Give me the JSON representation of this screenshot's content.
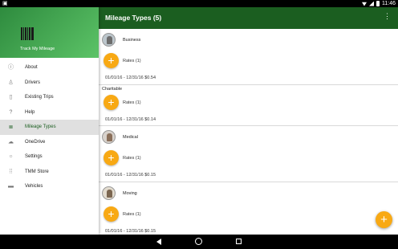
{
  "status_bar": {
    "time": "11:46"
  },
  "drawer": {
    "app_title": "Track My Mileage",
    "items": [
      {
        "label": "About",
        "icon": "info-icon"
      },
      {
        "label": "Drivers",
        "icon": "person-icon"
      },
      {
        "label": "Existing Trips",
        "icon": "clipboard-icon"
      },
      {
        "label": "Help",
        "icon": "help-icon"
      },
      {
        "label": "Mileage Types",
        "icon": "list-icon",
        "active": true
      },
      {
        "label": "OneDrive",
        "icon": "cloud-icon"
      },
      {
        "label": "Settings",
        "icon": "settings-icon"
      },
      {
        "label": "TMM Store",
        "icon": "grid-icon"
      },
      {
        "label": "Vehicles",
        "icon": "car-icon"
      }
    ]
  },
  "appbar": {
    "title": "Mileage Types (5)",
    "menu_icon": "more-vert-icon"
  },
  "cards": [
    {
      "name": "Business",
      "has_avatar": true,
      "rates_label": "Rates (1)",
      "range": "01/01/16 - 12/31/16 $0.54"
    },
    {
      "name": "Charitable",
      "has_avatar": false,
      "rates_label": "Rates (1)",
      "range": "01/01/16 - 12/31/16 $0.14"
    },
    {
      "name": "Medical",
      "has_avatar": true,
      "rates_label": "Rates (1)",
      "range": "01/01/16 - 12/31/16 $0.15"
    },
    {
      "name": "Moving",
      "has_avatar": true,
      "rates_label": "Rates (1)",
      "range": "01/01/16 - 12/31/16 $0.15"
    }
  ],
  "fab_label": "+",
  "colors": {
    "primary": "#1b5e20",
    "accent": "#f8a914",
    "header_gradient_end": "#5cc367"
  }
}
